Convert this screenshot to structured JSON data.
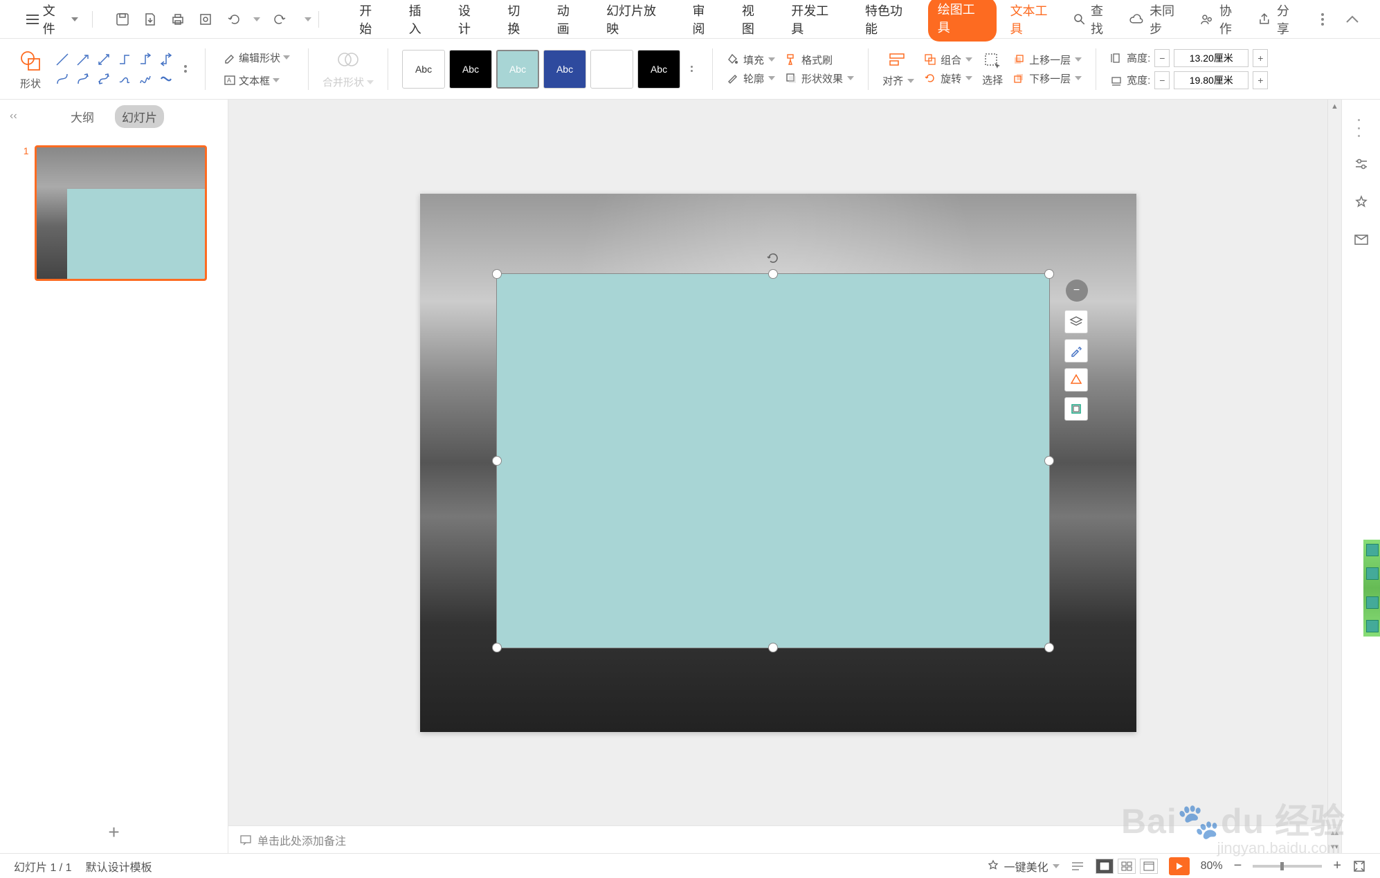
{
  "menubar": {
    "file": "文件",
    "tabs": [
      "开始",
      "插入",
      "设计",
      "切换",
      "动画",
      "幻灯片放映",
      "审阅",
      "视图",
      "开发工具",
      "特色功能"
    ],
    "drawing_tools": "绘图工具",
    "text_tools": "文本工具",
    "search": "查找",
    "unsync": "未同步",
    "collab": "协作",
    "share": "分享"
  },
  "ribbon": {
    "shape_label": "形状",
    "edit_shape": "编辑形状",
    "textbox": "文本框",
    "merge_shapes": "合并形状",
    "preset_abc": "Abc",
    "fill": "填充",
    "format_painter": "格式刷",
    "outline": "轮廓",
    "shape_effects": "形状效果",
    "align": "对齐",
    "group": "组合",
    "rotate": "旋转",
    "select": "选择",
    "bring_forward": "上移一层",
    "send_backward": "下移一层",
    "height_label": "高度:",
    "width_label": "宽度:",
    "height_value": "13.20厘米",
    "width_value": "19.80厘米"
  },
  "thumb": {
    "outline": "大纲",
    "slides": "幻灯片",
    "num1": "1"
  },
  "notes": {
    "placeholder": "单击此处添加备注"
  },
  "beautify": "一键美化",
  "status": {
    "slide_counter": "幻灯片 1 / 1",
    "template": "默认设计模板",
    "zoom": "80%"
  },
  "icons": {
    "minus": "−",
    "plus": "+"
  }
}
